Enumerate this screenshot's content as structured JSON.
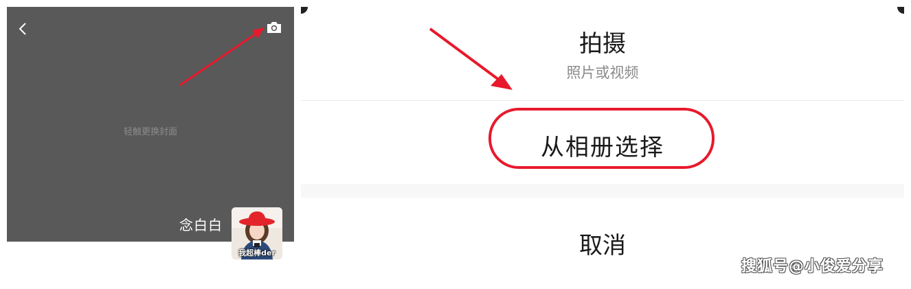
{
  "cover": {
    "hint": "轻触更换封面",
    "username": "念白白",
    "avatar_caption": "我超棒der",
    "background_color": "#595959"
  },
  "action_sheet": {
    "shoot_title": "拍摄",
    "shoot_subtitle": "照片或视频",
    "album_label": "从相册选择",
    "cancel_label": "取消"
  },
  "annotations": {
    "accent_color": "#e8192c"
  },
  "watermark": "搜狐号@小俊爱分享",
  "icons": [
    "back-icon",
    "camera-icon"
  ]
}
